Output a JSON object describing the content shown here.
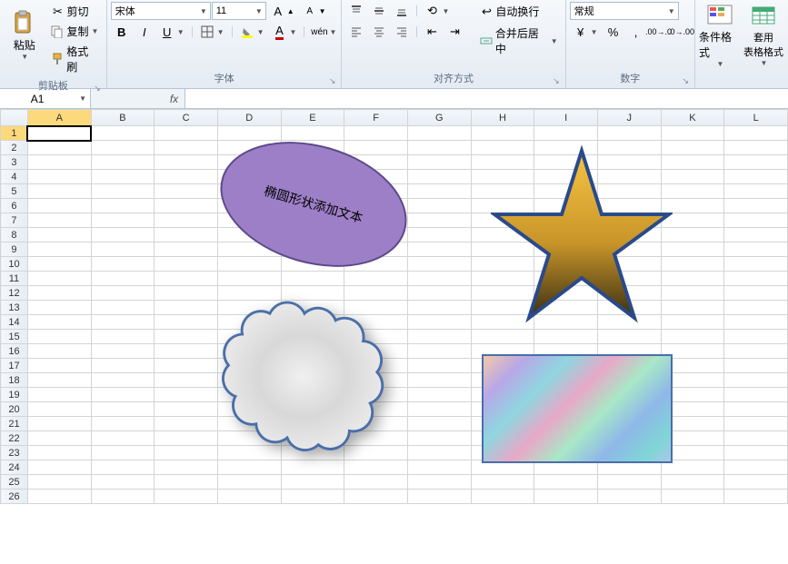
{
  "ribbon": {
    "clipboard": {
      "paste": "粘贴",
      "cut": "剪切",
      "copy": "复制",
      "painter": "格式刷",
      "label": "剪贴板"
    },
    "font": {
      "name": "宋体",
      "size": "11",
      "label": "字体"
    },
    "align": {
      "wrap": "自动换行",
      "merge": "合并后居中",
      "label": "对齐方式"
    },
    "number": {
      "format": "常规",
      "label": "数字"
    },
    "styles": {
      "condfmt": "条件格式",
      "tablefmt": "套用\n表格格式"
    }
  },
  "namebox": "A1",
  "formula": "",
  "columns": [
    "A",
    "B",
    "C",
    "D",
    "E",
    "F",
    "G",
    "H",
    "I",
    "J",
    "K",
    "L"
  ],
  "rows": 26,
  "active_cell": {
    "row": 1,
    "col": "A"
  },
  "shapes": {
    "ellipse_text": "椭圆形状添加文本"
  }
}
